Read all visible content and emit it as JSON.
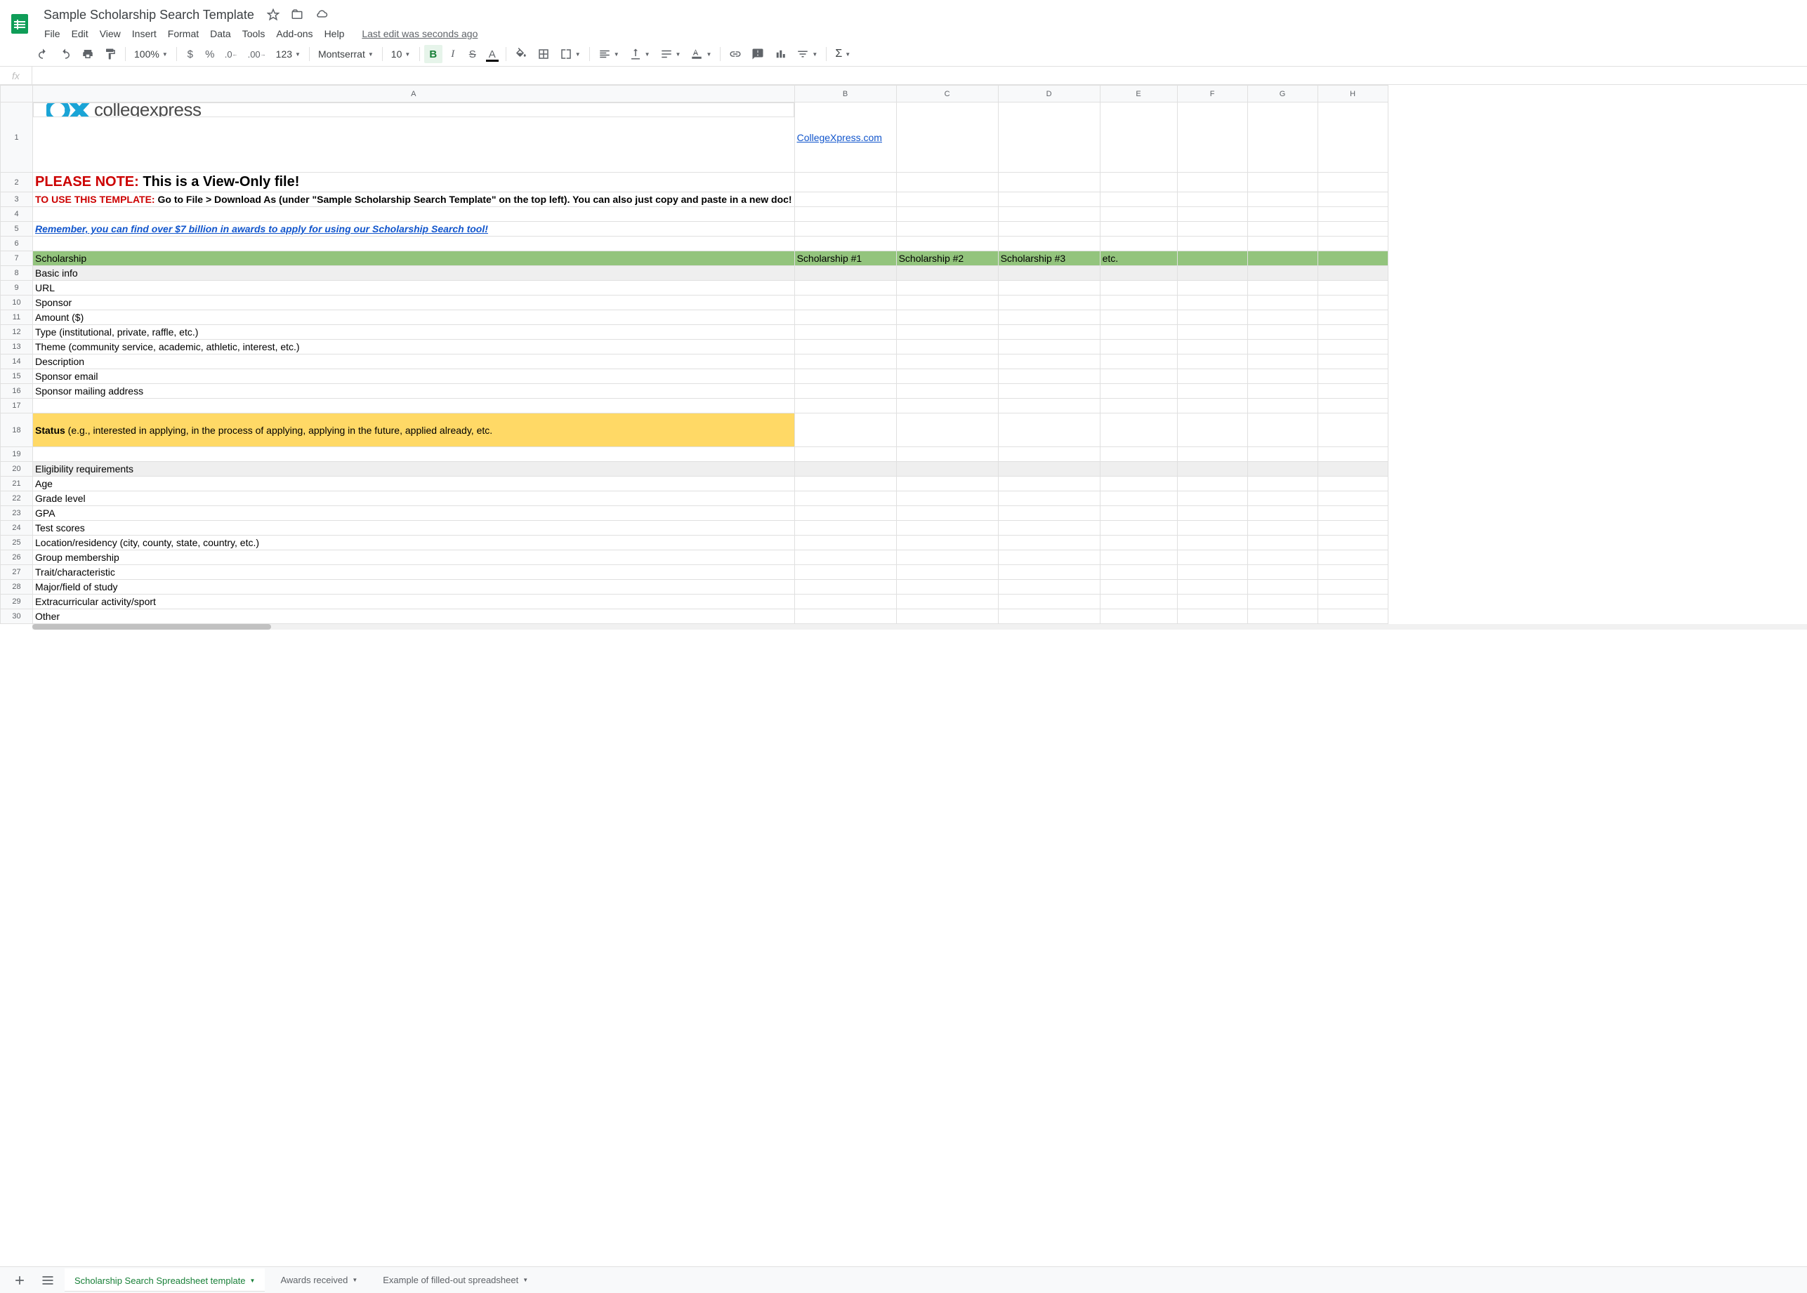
{
  "doc": {
    "title": "Sample Scholarship Search Template",
    "last_edit": "Last edit was seconds ago"
  },
  "menus": [
    "File",
    "Edit",
    "View",
    "Insert",
    "Format",
    "Data",
    "Tools",
    "Add-ons",
    "Help"
  ],
  "toolbar": {
    "zoom": "100%",
    "font": "Montserrat",
    "font_size": "10",
    "fmt_123": "123"
  },
  "columns": [
    "A",
    "B",
    "C",
    "D",
    "E",
    "F",
    "G",
    "H"
  ],
  "row_numbers": [
    "1",
    "2",
    "3",
    "4",
    "5",
    "6",
    "7",
    "8",
    "9",
    "10",
    "11",
    "12",
    "13",
    "14",
    "15",
    "16",
    "17",
    "18",
    "19",
    "20",
    "21",
    "22",
    "23",
    "24",
    "25",
    "26",
    "27",
    "28",
    "29",
    "30"
  ],
  "cells": {
    "logo_brand_mark": "CX",
    "logo_brand_text": "collegexpress",
    "b1_link": "CollegeXpress.com",
    "a2_red": "PLEASE NOTE:",
    "a2_black": " This is a View-Only file!",
    "a3_red": "TO USE THIS TEMPLATE:",
    "a3_black": " Go to File > Download As (under \"Sample Scholarship Search Template\" on the top left). You can also just copy and paste in a new doc!",
    "a5_link": "Remember, you can find over $7 billion in awards to apply for using our Scholarship Search tool!",
    "a7": "Scholarship",
    "b7": "Scholarship #1",
    "c7": "Scholarship #2",
    "d7": "Scholarship #3",
    "e7": "etc.",
    "a8": "Basic info",
    "a9": "URL",
    "a10": "Sponsor",
    "a11": "Amount ($)",
    "a12": "Type (institutional, private, raffle, etc.)",
    "a13": "Theme (community service, academic, athletic, interest, etc.)",
    "a14": "Description",
    "a15": "Sponsor email",
    "a16": "Sponsor mailing address",
    "a18_bold": "Status",
    "a18_rest": " (e.g., interested in applying, in the process of applying, applying in the future, applied already, etc.",
    "a20": "Eligibility requirements",
    "a21": "Age",
    "a22": "Grade level",
    "a23": "GPA",
    "a24": "Test scores",
    "a25": "Location/residency (city, county, state, country, etc.)",
    "a26": "Group membership",
    "a27": "Trait/characteristic",
    "a28": "Major/field of study",
    "a29": "Extracurricular activity/sport",
    "a30": "Other"
  },
  "sheets": {
    "tab1": "Scholarship Search Spreadsheet template",
    "tab2": "Awards received",
    "tab3": "Example of filled-out spreadsheet"
  }
}
